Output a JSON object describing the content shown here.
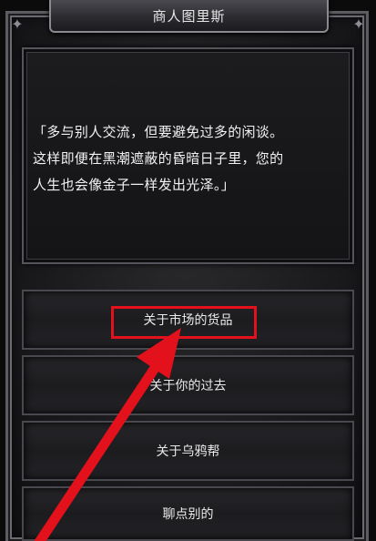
{
  "window": {
    "title": "商人图里斯"
  },
  "dialog": {
    "lines": [
      "「多与别人交流，但要避免过多的闲谈。",
      "这样即便在黑潮遮蔽的昏暗日子里，您的",
      "人生也会像金子一样发出光泽。」"
    ]
  },
  "options": [
    {
      "label": "关于市场的货品",
      "highlighted": true
    },
    {
      "label": "关于你的过去",
      "highlighted": false
    },
    {
      "label": "关于乌鸦帮",
      "highlighted": false
    },
    {
      "label": "聊点别的",
      "highlighted": false
    }
  ],
  "annotation": {
    "highlight_color": "#e3111b",
    "arrow_color": "#e3111b"
  }
}
